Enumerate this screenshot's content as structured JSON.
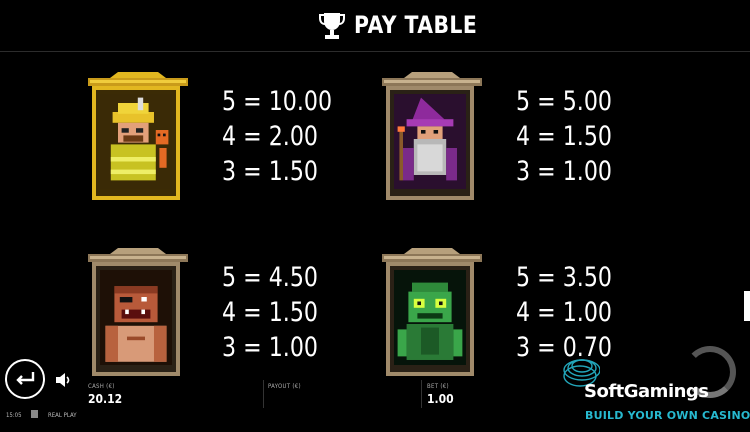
{
  "header": {
    "title": "PAY TABLE",
    "icon": "trophy-icon"
  },
  "symbols": [
    {
      "name": "firefighter",
      "lines": [
        "5 = 10.00",
        "4 = 2.00",
        "3 = 1.50"
      ],
      "frame": "gold"
    },
    {
      "name": "wizard",
      "lines": [
        "5 = 5.00",
        "4 = 1.50",
        "3 = 1.00"
      ],
      "frame": "stone"
    },
    {
      "name": "brute",
      "lines": [
        "5 = 4.50",
        "4 = 1.50",
        "3 = 1.00"
      ],
      "frame": "stone"
    },
    {
      "name": "zombie",
      "lines": [
        "5 = 3.50",
        "4 = 1.00",
        "3 = 0.70"
      ],
      "frame": "stone"
    }
  ],
  "status": {
    "cash_label": "CASH (€)",
    "cash_value": "20.12",
    "payout_label": "PAYOUT (€)",
    "bet_label": "BET (€)",
    "bet_value": "1.00",
    "time": "15:05",
    "mode": "REAL PLAY"
  },
  "watermark": {
    "name": "SoftGamings",
    "tagline": "BUILD YOUR OWN CASINO"
  },
  "colors": {
    "background": "#000000",
    "gold_frame": "#e2b720",
    "stone_frame": "#a08a6a",
    "accent": "#27b9cf"
  }
}
